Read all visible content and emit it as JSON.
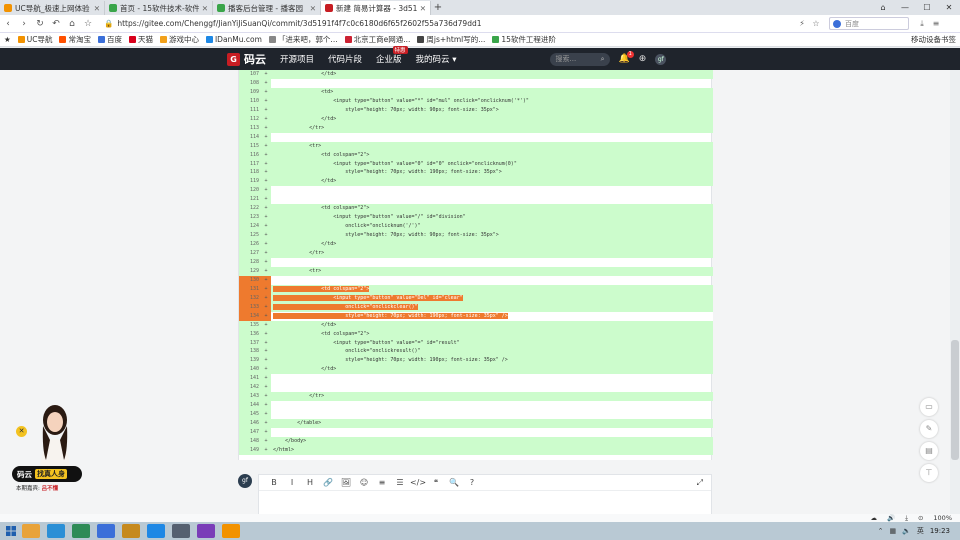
{
  "tabs": [
    {
      "title": "UC导航_极速上网体验",
      "color": "#f29200",
      "active": false
    },
    {
      "title": "首页 - 15软件技术-软件",
      "color": "#3aa54a",
      "active": false
    },
    {
      "title": "播客后台管理 - 播客园",
      "color": "#3aa54a",
      "active": false
    },
    {
      "title": "新建 简易计算器 - 3d51",
      "color": "#c71d23",
      "active": true
    }
  ],
  "address": {
    "url": "https://gitee.com/Chenggf/JianYiJiSuanQi/commit/3d5191f4f7c0c6180d6f65f2602f55a736d79dd1",
    "search_placeholder": "百度"
  },
  "bookmarks": [
    {
      "label": "UC导航",
      "color": "#f29200"
    },
    {
      "label": "常淘宝",
      "color": "#ff5000"
    },
    {
      "label": "百度",
      "color": "#3b6fd9"
    },
    {
      "label": "天猫",
      "color": "#d8001c"
    },
    {
      "label": "游戏中心",
      "color": "#f2a11b"
    },
    {
      "label": "IDanMu.com",
      "color": "#1e88e5"
    },
    {
      "label": "「进来吧，郭个...",
      "color": "#888"
    },
    {
      "label": "北京工商e网通...",
      "color": "#c23"
    },
    {
      "label": "周js+html写的...",
      "color": "#444"
    },
    {
      "label": "15软件工程进阶",
      "color": "#3aa54a"
    }
  ],
  "bookmarks_right": "移动设备书签",
  "gitee_nav": {
    "logo": "码云",
    "items": [
      "开源项目",
      "代码片段",
      "企业版"
    ],
    "badge": "特惠",
    "my": "我的码云 ▾",
    "search_placeholder": "搜索...",
    "notif_count": "1"
  },
  "diff_lines": [
    {
      "n": "107",
      "s": "+",
      "c": "                </td>",
      "t": "add"
    },
    {
      "n": "108",
      "s": "+",
      "c": "",
      "t": "add"
    },
    {
      "n": "109",
      "s": "+",
      "c": "                <td>",
      "t": "add"
    },
    {
      "n": "110",
      "s": "+",
      "c": "                    <input type=\"button\" value=\"*\" id=\"mul\" onclick=\"onclicknum('*')\"",
      "t": "add"
    },
    {
      "n": "111",
      "s": "+",
      "c": "                        style=\"height: 70px; width: 90px; font-size: 35px\">",
      "t": "add"
    },
    {
      "n": "112",
      "s": "+",
      "c": "                </td>",
      "t": "add"
    },
    {
      "n": "113",
      "s": "+",
      "c": "            </tr>",
      "t": "add"
    },
    {
      "n": "114",
      "s": "+",
      "c": "",
      "t": "add"
    },
    {
      "n": "115",
      "s": "+",
      "c": "            <tr>",
      "t": "add"
    },
    {
      "n": "116",
      "s": "+",
      "c": "                <td colspan=\"2\">",
      "t": "add"
    },
    {
      "n": "117",
      "s": "+",
      "c": "                    <input type=\"button\" value=\"0\" id=\"0\" onclick=\"onclicknum(0)\"",
      "t": "add"
    },
    {
      "n": "118",
      "s": "+",
      "c": "                        style=\"height: 70px; width: 190px; font-size: 35px\">",
      "t": "add"
    },
    {
      "n": "119",
      "s": "+",
      "c": "                </td>",
      "t": "add"
    },
    {
      "n": "120",
      "s": "+",
      "c": "",
      "t": "add"
    },
    {
      "n": "121",
      "s": "+",
      "c": "",
      "t": "add"
    },
    {
      "n": "122",
      "s": "+",
      "c": "                <td colspan=\"2\">",
      "t": "add"
    },
    {
      "n": "123",
      "s": "+",
      "c": "                    <input type=\"button\" value=\"/\" id=\"division\"",
      "t": "add"
    },
    {
      "n": "124",
      "s": "+",
      "c": "                        onclick=\"onclicknum('/')\"",
      "t": "add"
    },
    {
      "n": "125",
      "s": "+",
      "c": "                        style=\"height: 70px; width: 90px; font-size: 35px\">",
      "t": "add"
    },
    {
      "n": "126",
      "s": "+",
      "c": "                </td>",
      "t": "add"
    },
    {
      "n": "127",
      "s": "+",
      "c": "            </tr>",
      "t": "add"
    },
    {
      "n": "128",
      "s": "+",
      "c": "",
      "t": "add"
    },
    {
      "n": "129",
      "s": "+",
      "c": "            <tr>",
      "t": "add"
    },
    {
      "n": "130",
      "s": "+",
      "c": "",
      "t": "sel"
    },
    {
      "n": "131",
      "s": "+",
      "c": "                <td colspan=\"2\">",
      "t": "sel"
    },
    {
      "n": "132",
      "s": "+",
      "c": "                    <input type=\"button\" value=\"Del\" id=\"clear\"",
      "t": "sel"
    },
    {
      "n": "133",
      "s": "+",
      "c": "                        onclick=\"onclickclear()\"",
      "t": "sel"
    },
    {
      "n": "134",
      "s": "+",
      "c": "                        style=\"height: 70px; width: 190px; font-size: 35px\" />",
      "t": "selcur"
    },
    {
      "n": "135",
      "s": "+",
      "c": "                </td>",
      "t": "add"
    },
    {
      "n": "136",
      "s": "+",
      "c": "                <td colspan=\"2\">",
      "t": "add"
    },
    {
      "n": "137",
      "s": "+",
      "c": "                    <input type=\"button\" value=\"=\" id=\"result\"",
      "t": "add"
    },
    {
      "n": "138",
      "s": "+",
      "c": "                        onclick=\"onclickresult()\"",
      "t": "add"
    },
    {
      "n": "139",
      "s": "+",
      "c": "                        style=\"height: 70px; width: 190px; font-size: 35px\" />",
      "t": "add"
    },
    {
      "n": "140",
      "s": "+",
      "c": "                </td>",
      "t": "add"
    },
    {
      "n": "141",
      "s": "+",
      "c": "",
      "t": "add"
    },
    {
      "n": "142",
      "s": "+",
      "c": "",
      "t": "add"
    },
    {
      "n": "143",
      "s": "+",
      "c": "            </tr>",
      "t": "add"
    },
    {
      "n": "144",
      "s": "+",
      "c": "",
      "t": "add"
    },
    {
      "n": "145",
      "s": "+",
      "c": "",
      "t": "add"
    },
    {
      "n": "146",
      "s": "+",
      "c": "        </table>",
      "t": "add"
    },
    {
      "n": "147",
      "s": "+",
      "c": "",
      "t": "add"
    },
    {
      "n": "148",
      "s": "+",
      "c": "    </body>",
      "t": "add"
    },
    {
      "n": "149",
      "s": "+",
      "c": "</html>",
      "t": "add"
    }
  ],
  "editor": {
    "avatar": "gf",
    "tools": [
      "B",
      "I",
      "H",
      "🔗",
      "🖼",
      "☺",
      "≡",
      "☰",
      "</>",
      "❝",
      "🔍",
      "?"
    ]
  },
  "ad": {
    "title": "码云",
    "highlight": "找真人身",
    "sub_label": "本期嘉宾:",
    "sub_value": "吕不懂"
  },
  "status": {
    "zoom": "100%"
  },
  "taskbar": {
    "time": "19:23"
  },
  "colors": {
    "added_bg": "#ccfccc",
    "selection": "#ee7a2e",
    "nav_bg": "#1f242c",
    "brand": "#c71d23"
  }
}
